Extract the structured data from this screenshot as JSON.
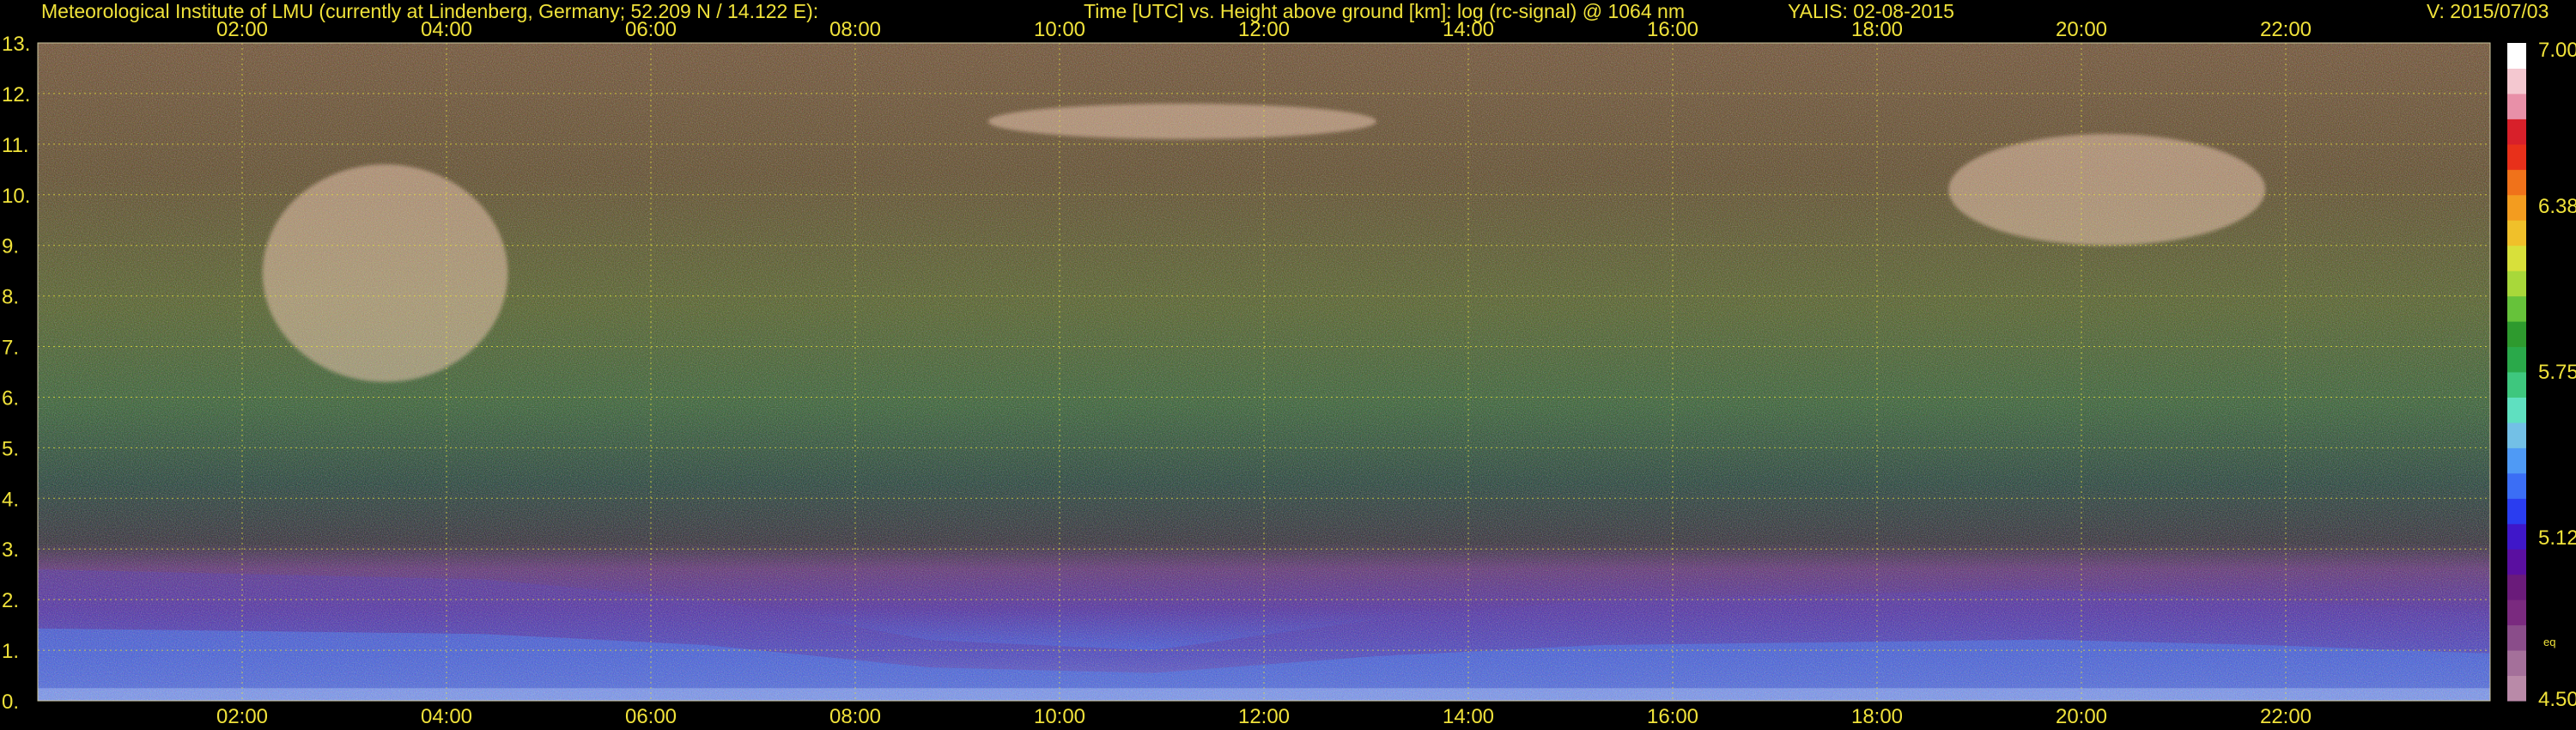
{
  "header": {
    "institute": "Meteorological Institute of LMU (currently at Lindenberg, Germany; 52.209 N / 14.122 E):",
    "description": "Time [UTC] vs. Height above ground [km]: log (rc-signal) @ 1064 nm",
    "instrument_date": "YALIS: 02-08-2015",
    "version": "V: 2015/07/03"
  },
  "colors": {
    "background": "#000000",
    "text": "#f0e23a",
    "grid": "#e8e23a"
  },
  "chart_data": {
    "type": "heatmap",
    "title": "Time [UTC] vs. Height above ground [km]: log (rc-signal) @ 1064 nm",
    "xlabel": "",
    "ylabel": "",
    "x_unit": "UTC hour",
    "x_range": [
      0,
      24
    ],
    "y_range": [
      0,
      13
    ],
    "x_ticks": [
      2,
      4,
      6,
      8,
      10,
      12,
      14,
      16,
      18,
      20,
      22
    ],
    "x_tick_labels": [
      "02:00",
      "04:00",
      "06:00",
      "08:00",
      "10:00",
      "12:00",
      "14:00",
      "16:00",
      "18:00",
      "20:00",
      "22:00"
    ],
    "y_ticks": [
      0,
      1,
      2,
      3,
      4,
      5,
      6,
      7,
      8,
      9,
      10,
      11,
      12,
      13
    ],
    "y_tick_labels": [
      "0.",
      "1.",
      "2.",
      "3.",
      "4.",
      "5.",
      "6.",
      "7.",
      "8.",
      "9.",
      "10.",
      "11.",
      "12.",
      "13."
    ],
    "grid": true,
    "colorbar": {
      "min": 4.5,
      "max": 7.0,
      "tick_values": [
        7.0,
        6.38,
        5.75,
        5.12,
        4.5
      ],
      "tick_labels": [
        "7.00",
        "6.38",
        "5.75",
        "5.12",
        "4.50"
      ],
      "note": "eq",
      "palette": [
        "#b98aa8",
        "#a4709a",
        "#8a4d8a",
        "#7a2a7f",
        "#6a1b7a",
        "#5a0fa0",
        "#3f17c9",
        "#2a3df0",
        "#3b6ef5",
        "#4f9af5",
        "#73c0e6",
        "#5fe0c0",
        "#3ec77e",
        "#2aa94a",
        "#2e9a2e",
        "#66c23a",
        "#a8d83a",
        "#d8e03a",
        "#f0c02a",
        "#f39c1f",
        "#f0721a",
        "#e8301a",
        "#d8202a",
        "#e890a8",
        "#f4c8d0",
        "#ffffff"
      ]
    },
    "features": [
      {
        "name": "boundary layer aerosol",
        "x_start": 0,
        "x_end": 24,
        "top_km": [
          2.6,
          2.5,
          2.4,
          2.0,
          1.2,
          1.0,
          1.6,
          2.0,
          2.1,
          2.2,
          2.0,
          1.7
        ]
      },
      {
        "name": "cirrus",
        "x_start": 2.2,
        "x_end": 4.6,
        "y_start": 6.3,
        "y_end": 10.6
      },
      {
        "name": "cirrus",
        "x_start": 9.3,
        "x_end": 13.1,
        "y_start": 11.1,
        "y_end": 11.8
      },
      {
        "name": "cirrus",
        "x_start": 18.7,
        "x_end": 21.8,
        "y_start": 9.0,
        "y_end": 11.2
      }
    ]
  }
}
